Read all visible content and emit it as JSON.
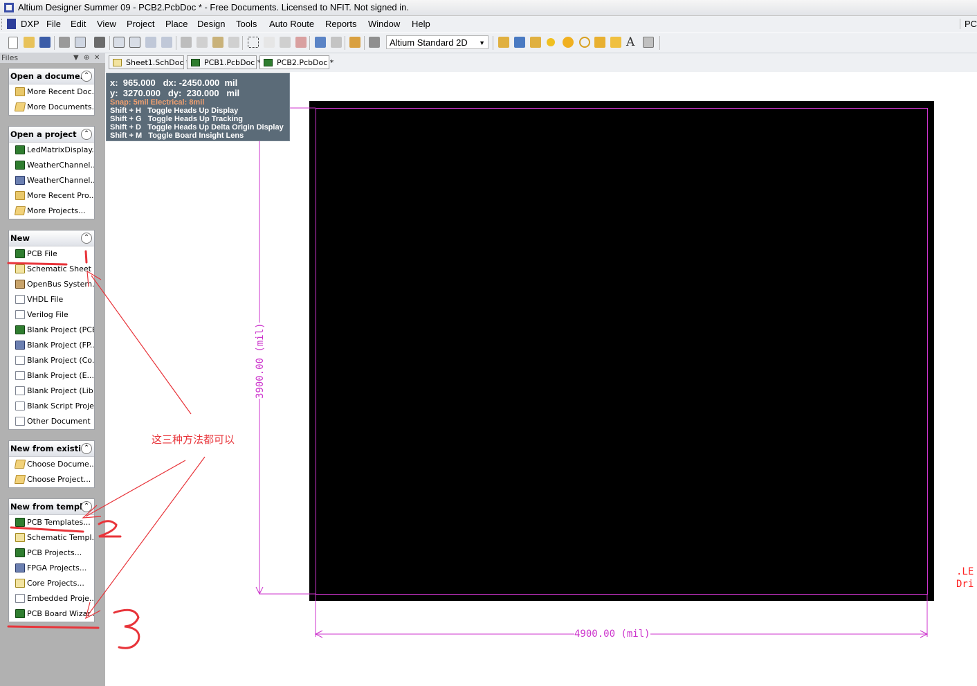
{
  "window": {
    "title": "Altium Designer Summer 09 - PCB2.PcbDoc * - Free Documents. Licensed to NFIT. Not signed in."
  },
  "menu": {
    "items": [
      "DXP",
      "File",
      "Edit",
      "View",
      "Project",
      "Place",
      "Design",
      "Tools",
      "Auto Route",
      "Reports",
      "Window",
      "Help"
    ],
    "right_label": "PC"
  },
  "toolbar": {
    "view_select": "Altium Standard 2D"
  },
  "files_panel": {
    "title": "Files",
    "groups": [
      {
        "title": "Open a docume...",
        "items": [
          "More Recent Doc...",
          "More Documents..."
        ]
      },
      {
        "title": "Open a project",
        "items": [
          "LedMatrixDisplay...",
          "WeatherChannel...",
          "WeatherChannel...",
          "More Recent Pro...",
          "More Projects..."
        ]
      },
      {
        "title": "New",
        "items": [
          "PCB File",
          "Schematic Sheet",
          "OpenBus System...",
          "VHDL File",
          "Verilog File",
          "Blank Project (PCB)",
          "Blank Project (FP...",
          "Blank Project (Co...",
          "Blank Project (E...",
          "Blank Project (Lib...",
          "Blank Script Project",
          "Other Document"
        ]
      },
      {
        "title": "New from existi...",
        "items": [
          "Choose Docume...",
          "Choose Project..."
        ]
      },
      {
        "title": "New from templ...",
        "items": [
          "PCB Templates...",
          "Schematic Templ...",
          "PCB Projects...",
          "FPGA Projects...",
          "Core Projects...",
          "Embedded Proje...",
          "PCB Board Wizar..."
        ]
      }
    ]
  },
  "doc_tabs": [
    "Sheet1.SchDoc *",
    "PCB1.PcbDoc *",
    "PCB2.PcbDoc *"
  ],
  "hud": {
    "line1": "x:  965.000   dx: -2450.000  mil",
    "line2": "y:  3270.000   dy:  230.000   mil",
    "snap": "Snap: 5mil Electrical: 8mil",
    "shortcuts": [
      "Shift + H   Toggle Heads Up Display",
      "Shift + G   Toggle Heads Up Tracking",
      "Shift + D   Toggle Heads Up Delta Origin Display",
      "Shift + M   Toggle Board Insight Lens"
    ]
  },
  "board": {
    "width_label": "4900.00 (mil)",
    "height_label": "3900.00 (mil)",
    "board_color": "#000000",
    "dimension_color": "#cc33cc"
  },
  "offscreen_text": [
    ".LE",
    "Dri"
  ],
  "annotation": {
    "note": "这三种方法都可以",
    "marks": [
      "1",
      "2",
      "3"
    ],
    "color": "#e8343a"
  }
}
